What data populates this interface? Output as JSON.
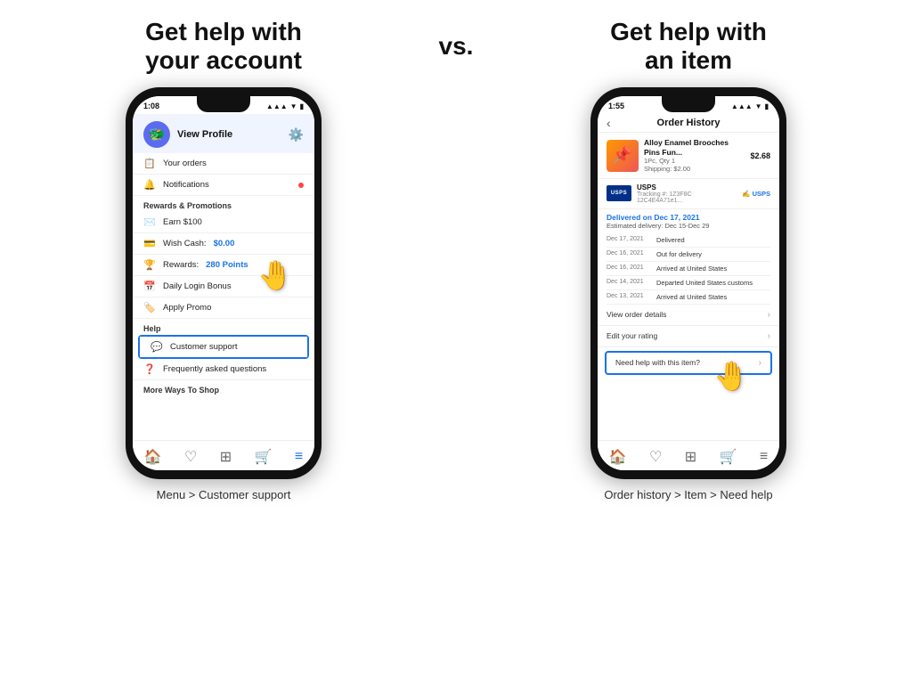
{
  "left_heading": "Get help with\nyour account",
  "vs_text": "vs.",
  "right_heading": "Get help with\nan item",
  "left_instruction": "Menu > Customer support",
  "right_instruction": "Order history > Item > Need help",
  "left_phone": {
    "status_time": "1:08",
    "profile": {
      "view_text": "View Profile"
    },
    "menu_items": [
      {
        "icon": "📋",
        "label": "Your orders"
      },
      {
        "icon": "🔔",
        "label": "Notifications",
        "has_dot": true
      }
    ],
    "rewards_header": "Rewards & Promotions",
    "rewards_items": [
      {
        "icon": "✉️",
        "label": "Earn $100"
      },
      {
        "icon": "💳",
        "label": "Wish Cash:",
        "value": "$0.00"
      },
      {
        "icon": "🏆",
        "label": "Rewards:",
        "value": "280 Points"
      },
      {
        "icon": "📅",
        "label": "Daily Login Bonus"
      },
      {
        "icon": "🏷️",
        "label": "Apply Promo"
      }
    ],
    "help_header": "Help",
    "help_items": [
      {
        "icon": "💬",
        "label": "Customer support",
        "highlighted": true
      },
      {
        "icon": "❓",
        "label": "Frequently asked questions"
      }
    ],
    "more_header": "More Ways To Shop"
  },
  "right_phone": {
    "status_time": "1:55",
    "header_title": "Order History",
    "product": {
      "name": "Alloy Enamel Brooches Pins Fun...",
      "qty": "1Pc, Qty 1",
      "shipping": "Shipping: $2.00",
      "price": "$2.68"
    },
    "shipping": {
      "carrier": "USPS",
      "tracking": "Tracking #: 1Z3F8C 12C4E4A71e1...",
      "link": "✍ USPS"
    },
    "delivery": {
      "title": "Delivered on Dec 17, 2021",
      "subtitle": "Estimated delivery: Dec 15-Dec 29"
    },
    "tracking_events": [
      {
        "date": "Dec 17, 2021",
        "status": "Delivered"
      },
      {
        "date": "Dec 16, 2021",
        "status": "Out for delivery"
      },
      {
        "date": "Dec 16, 2021",
        "status": "Arrived at United States"
      },
      {
        "date": "Dec 14, 2021",
        "status": "Departed United States customs"
      },
      {
        "date": "Dec 13, 2021",
        "status": "Arrived at United States"
      }
    ],
    "actions": [
      {
        "label": "View order details"
      },
      {
        "label": "Edit your rating"
      },
      {
        "label": "Need help with this item?",
        "highlighted": true
      }
    ]
  }
}
